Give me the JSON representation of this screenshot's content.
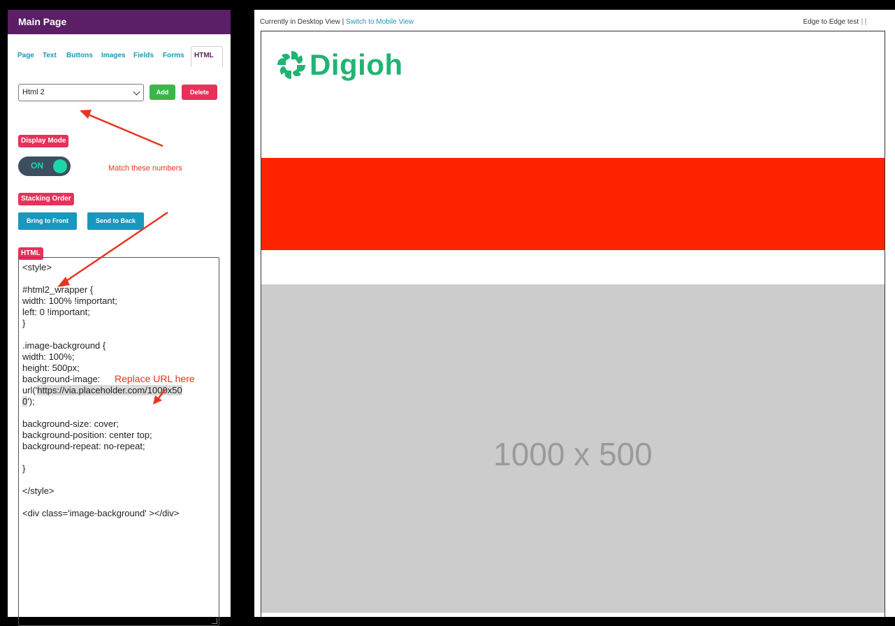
{
  "panel": {
    "title": "Main Page",
    "tabs": [
      "Page",
      "Text",
      "Buttons",
      "Images",
      "Fields",
      "Forms",
      "HTML"
    ],
    "active_tab": "HTML",
    "select_value": "Html 2",
    "add_label": "Add",
    "delete_label": "Delete",
    "display_mode_label": "Display Mode",
    "toggle_label": "ON",
    "stacking_label": "Stacking Order",
    "bring_front_label": "Bring to Front",
    "send_back_label": "Send to Back",
    "html_label": "HTML",
    "code": {
      "line1": "<style>",
      "line2": "",
      "line3": "#html2_wrapper {",
      "line4": "width: 100% !important;",
      "line5": "left: 0 !important;",
      "line6": "}",
      "line7": "",
      "line8": ".image-background {",
      "line9": "width: 100%;",
      "line10": "height: 500px;",
      "line11": "background-image:",
      "line12_pre": "url('",
      "line12_url": "https://via.placeholder.com/1000x50",
      "line13_url": "0",
      "line13_post": "');",
      "line14": "",
      "line15": "background-size: cover;",
      "line16": "background-position: center top;",
      "line17": "background-repeat: no-repeat;",
      "line18": "",
      "line19": "}",
      "line20": "",
      "line21": "</style>",
      "line22": "",
      "line23": "<div class='image-background' ></div>"
    }
  },
  "annotations": {
    "match_numbers": "Match these numbers",
    "replace_url": "Replace URL here",
    "arrow_color": "#e8341e"
  },
  "preview": {
    "view_text": "Currently in Desktop View | ",
    "switch_link": "Switch to Mobile View",
    "test_name": "Edge to Edge test",
    "logo_text": "Digioh",
    "placeholder_text": "1000 x 500",
    "logo_color": "#22b373",
    "band_color": "#ff2400",
    "placeholder_color": "#cccccc"
  }
}
